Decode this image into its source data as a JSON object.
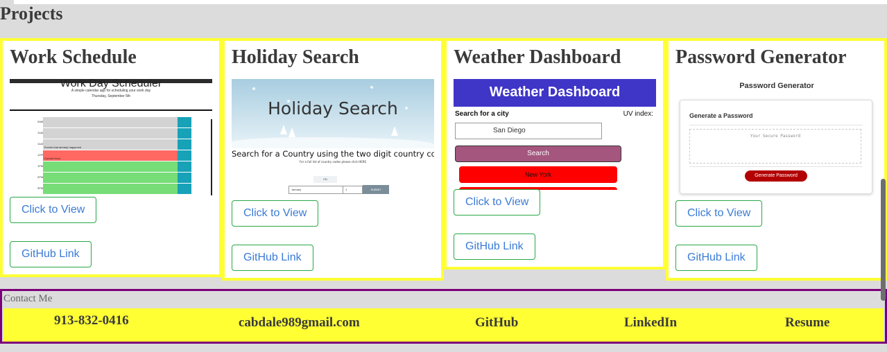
{
  "projects": {
    "heading": "Projects",
    "cards": [
      {
        "title": "Work Schedule",
        "view_label": "Click to View",
        "github_label": "GitHub Link"
      },
      {
        "title": "Holiday Search",
        "view_label": "Click to View",
        "github_label": "GitHub Link"
      },
      {
        "title": "Weather Dashboard",
        "view_label": "Click to View",
        "github_label": "GitHub Link"
      },
      {
        "title": "Password Generator",
        "view_label": "Click to View",
        "github_label": "GitHub Link"
      }
    ]
  },
  "thumbs": {
    "work": {
      "title": "Work Day Scheduler",
      "subtitle": "A simple calendar app for scheduling your work day",
      "date": "Thursday, September 5th",
      "hours": [
        "9AM",
        "10AM",
        "11AM",
        "12PM",
        "1PM",
        "2PM",
        "3PM"
      ],
      "notes": [
        "",
        "",
        "Events that already happened",
        "Current Hour",
        "",
        "",
        ""
      ],
      "colors": [
        "#d3d3d3",
        "#d3d3d3",
        "#d3d3d3",
        "#ff6961",
        "#77dd77",
        "#77dd77",
        "#77dd77"
      ]
    },
    "holiday": {
      "title": "Holiday Search",
      "subtitle": "Search for a Country using the two digit country code.",
      "hint": "For a full list of country codes please click HERE",
      "code": "CD",
      "month": "January",
      "day": "1",
      "submit": "SUBMIT"
    },
    "weather": {
      "header": "Weather Dashboard",
      "search_label": "Search for a city",
      "uv_label": "UV index:",
      "input_value": "San Diego",
      "search_button": "Search",
      "city": "New York"
    },
    "password": {
      "title": "Password Generator",
      "card_title": "Generate a Password",
      "placeholder": "Your Secure Password",
      "button": "Generate Password"
    }
  },
  "contact": {
    "heading": "Contact Me",
    "phone": "913-832-0416",
    "email": "cabdale989gmail.com",
    "github": "GitHub",
    "linkedin": "LinkedIn",
    "resume": "Resume"
  }
}
